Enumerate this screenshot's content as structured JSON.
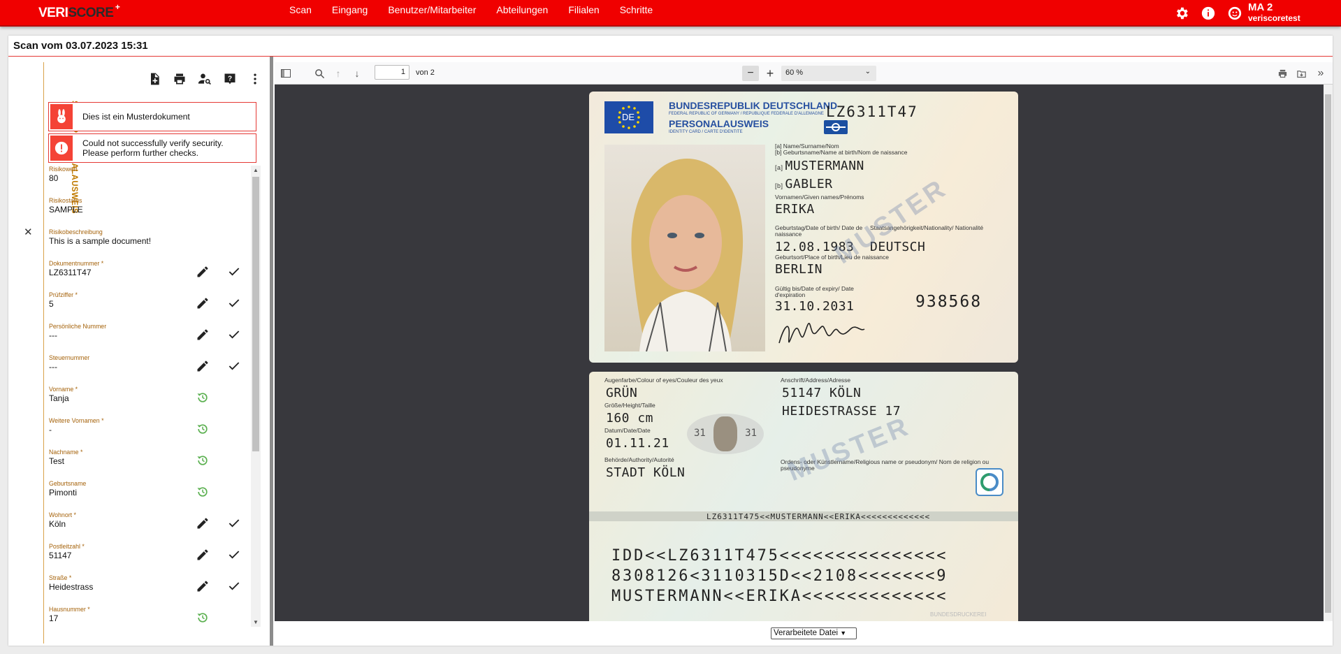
{
  "app": {
    "logo": "VERISCORE",
    "logo_plus": "+"
  },
  "nav": {
    "items": [
      "Scan",
      "Eingang",
      "Benutzer/Mitarbeiter",
      "Abteilungen",
      "Filialen",
      "Schritte"
    ]
  },
  "user": {
    "name": "MA 2",
    "account": "veriscoretest"
  },
  "page": {
    "title": "Scan vom 03.07.2023 15:31",
    "tab_label": "SCAN-PERSONALAUSWEIS"
  },
  "alerts": [
    {
      "icon": "rabbit-icon",
      "text": "Dies ist ein Musterdokument"
    },
    {
      "icon": "exclamation-icon",
      "text": "Could not successfully verify security. Please perform further checks."
    }
  ],
  "fields": [
    {
      "label": "Risikowert",
      "value": "80",
      "actions": "none"
    },
    {
      "label": "Risikostatus",
      "value": "SAMPLE",
      "actions": "none"
    },
    {
      "label": "Risikobeschreibung",
      "value": "This is a sample document!",
      "actions": "none"
    },
    {
      "label": "Dokumentnummer *",
      "value": "LZ6311T47",
      "actions": "edit-confirm"
    },
    {
      "label": "Prüfziffer *",
      "value": "5",
      "actions": "edit-confirm"
    },
    {
      "label": "Persönliche Nummer",
      "value": "---",
      "actions": "edit-confirm"
    },
    {
      "label": "Steuernummer",
      "value": "---",
      "actions": "edit-confirm"
    },
    {
      "label": "Vorname *",
      "value": "Tanja",
      "actions": "restore"
    },
    {
      "label": "Weitere Vornamen *",
      "value": "-",
      "actions": "restore"
    },
    {
      "label": "Nachname *",
      "value": "Test",
      "actions": "restore"
    },
    {
      "label": "Geburtsname",
      "value": "Pimonti",
      "actions": "restore"
    },
    {
      "label": "Wohnort *",
      "value": "Köln",
      "actions": "edit-confirm"
    },
    {
      "label": "Postleitzahl *",
      "value": "51147",
      "actions": "edit-confirm"
    },
    {
      "label": "Straße *",
      "value": "Heidestrass",
      "actions": "edit-confirm"
    },
    {
      "label": "Hausnummer *",
      "value": "17",
      "actions": "restore"
    }
  ],
  "viewer": {
    "page_current": "1",
    "page_total": "von 2",
    "zoom": "60 %"
  },
  "id_front": {
    "country": "BUNDESREPUBLIK DEUTSCHLAND",
    "country_sub": "FEDERAL REPUBLIC OF GERMANY / REPUBLIQUE FEDERALE D'ALLEMAGNE",
    "doc_type": "PERSONALAUSWEIS",
    "doc_type_sub": "IDENTITY CARD / CARTE D'IDENTITE",
    "eu_code": "DE",
    "card_no": "LZ6311T47",
    "name_label_a": "[a] Name/Surname/Nom",
    "name_label_b": "[b] Geburtsname/Name at birth/Nom de naissance",
    "surname": "MUSTERMANN",
    "birthname": "GABLER",
    "given_label": "Vornamen/Given names/Prénoms",
    "given": "ERIKA",
    "dob_label": "Geburtstag/Date of birth/ Date de naissance",
    "nat_label": "Staatsangehörigkeit/Nationality/ Nationalité",
    "dob": "12.08.1983",
    "nationality": "DEUTSCH",
    "pob_label": "Geburtsort/Place of birth/Lieu de naissance",
    "pob": "BERLIN",
    "exp_label": "Gültig bis/Date of expiry/ Date d'expiration",
    "expiry": "31.10.2031",
    "can": "938568",
    "watermark": "MUSTER"
  },
  "id_back": {
    "eyes_label": "Augenfarbe/Colour of eyes/Couleur des yeux",
    "eyes": "GRÜN",
    "height_label": "Größe/Height/Taille",
    "height": "160 cm",
    "issue_label": "Datum/Date/Date",
    "issue": "01.11.21",
    "authority_label": "Behörde/Authority/Autorité",
    "authority": "STADT KÖLN",
    "addr_label": "Anschrift/Address/Adresse",
    "addr1": "51147 KÖLN",
    "addr2": "HEIDESTRASSE 17",
    "religious_label": "Ordens- oder Künstlername/Religious name or pseudonym/ Nom de religion ou pseudonyme",
    "mrz_small": "LZ6311T475<<MUSTERMANN<<ERIKA<<<<<<<<<<<<<",
    "mrz1": "IDD<<LZ6311T475<<<<<<<<<<<<<<<",
    "mrz2": "8308126<3110315D<<2108<<<<<<<9",
    "mrz3": "MUSTERMANN<<ERIKA<<<<<<<<<<<<<",
    "ghost_num_left": "31",
    "ghost_num_right": "31",
    "footer": "BUNDESDRUCKEREI",
    "watermark": "MUSTER"
  },
  "file_select": {
    "selected": "Verarbeitete Datei"
  },
  "colors": {
    "brand_red": "#f00000",
    "label_orange": "#a5620a",
    "restore_green": "#5bb050"
  }
}
